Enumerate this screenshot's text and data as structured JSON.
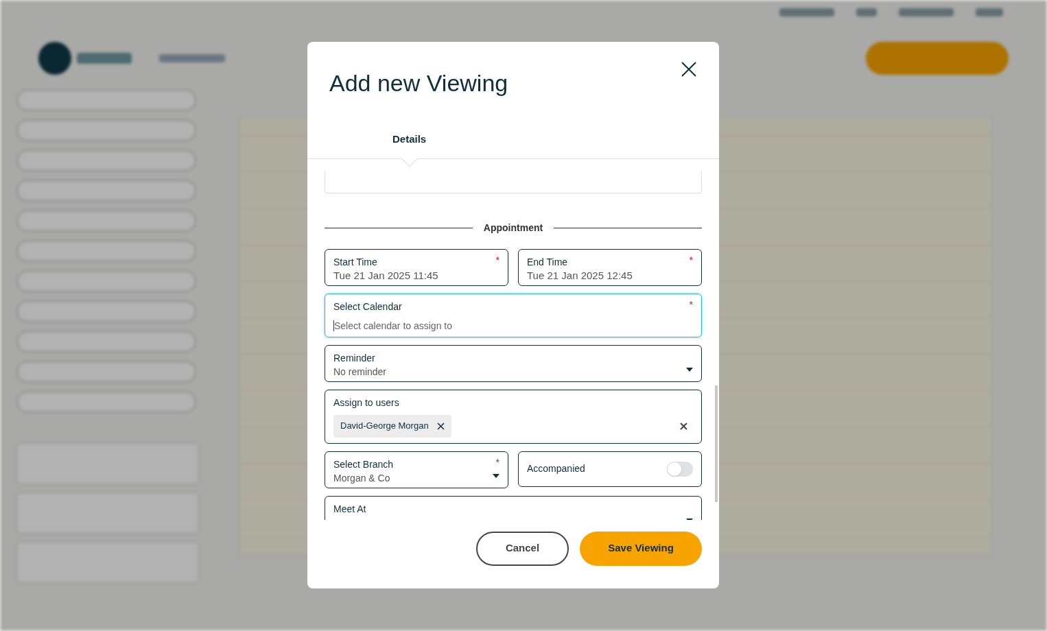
{
  "dialog": {
    "title": "Add new Viewing",
    "tabs": [
      {
        "label": "Details",
        "selected": true
      }
    ],
    "section": "Appointment",
    "required_mark": "*",
    "rows": [
      [
        {
          "kind": "text",
          "label": "Start Time",
          "value": "Tue 21 Jan 2025 11:45",
          "required": true,
          "focused": false
        },
        {
          "kind": "text",
          "label": "End Time",
          "value": "Tue 21 Jan 2025 12:45",
          "required": true,
          "focused": false
        }
      ],
      [
        {
          "kind": "search",
          "label": "Select Calendar",
          "placeholder": "Select calendar to assign to",
          "required": true,
          "focused": true
        }
      ],
      [
        {
          "kind": "select",
          "label": "Reminder",
          "value": "No reminder",
          "focused": false
        }
      ],
      [
        {
          "kind": "users",
          "label": "Assign to users",
          "chips": [
            "David-George Morgan"
          ],
          "focused": false
        }
      ],
      [
        {
          "kind": "select",
          "label": "Select Branch",
          "value": "Morgan & Co",
          "required": true,
          "focused": false
        },
        {
          "kind": "toggle",
          "label": "Accompanied",
          "on": false
        }
      ],
      [
        {
          "kind": "select",
          "label": "Meet At",
          "focused": false
        }
      ]
    ],
    "buttons": [
      {
        "label": "Cancel",
        "kind": "secondary"
      },
      {
        "label": "Save Viewing",
        "kind": "primary"
      }
    ]
  }
}
